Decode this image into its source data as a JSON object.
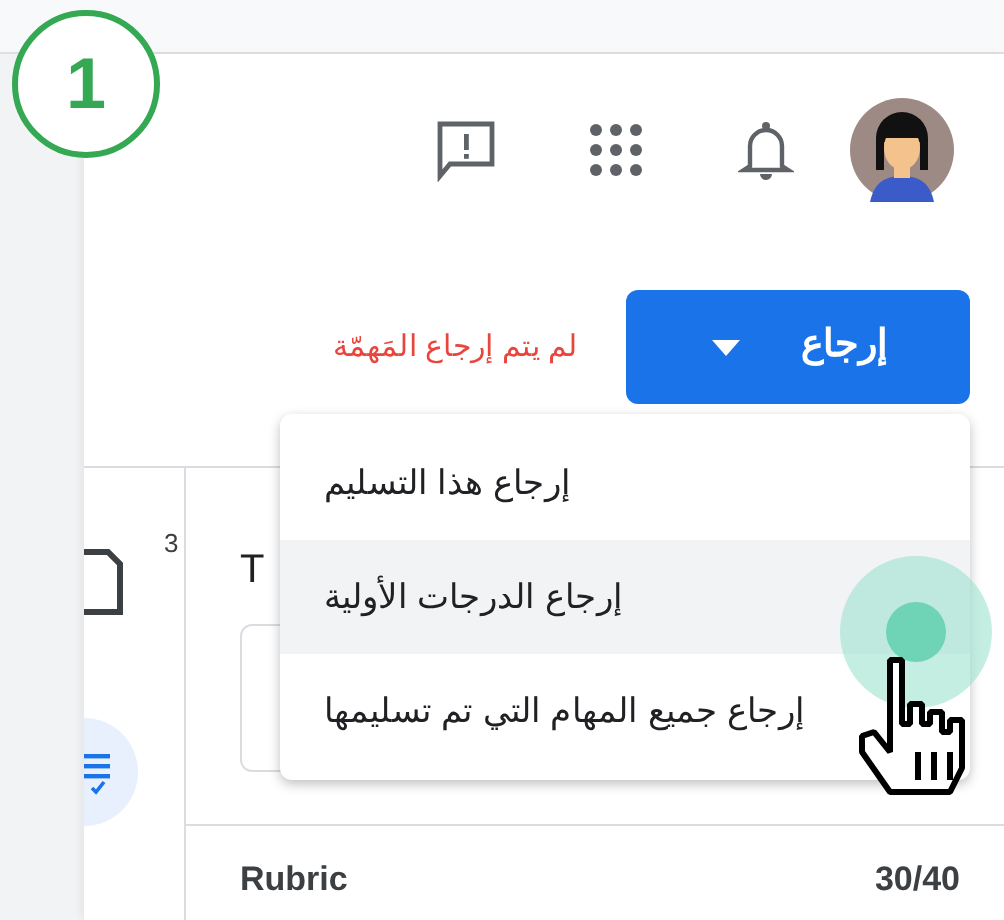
{
  "step_badge": "1",
  "return_button": {
    "label": "إرجاع"
  },
  "status_message": "لم يتم إرجاع المَهمّة",
  "menu": {
    "items": [
      {
        "label": "إرجاع هذا التسليم",
        "hovered": false
      },
      {
        "label": "إرجاع الدرجات الأولية",
        "hovered": true
      },
      {
        "label": "إرجاع جميع المهام التي تم تسليمها",
        "hovered": false
      }
    ]
  },
  "sidebar": {
    "count": "3"
  },
  "panel": {
    "heading": "T",
    "rubric_label": "Rubric",
    "score": "30/40"
  }
}
